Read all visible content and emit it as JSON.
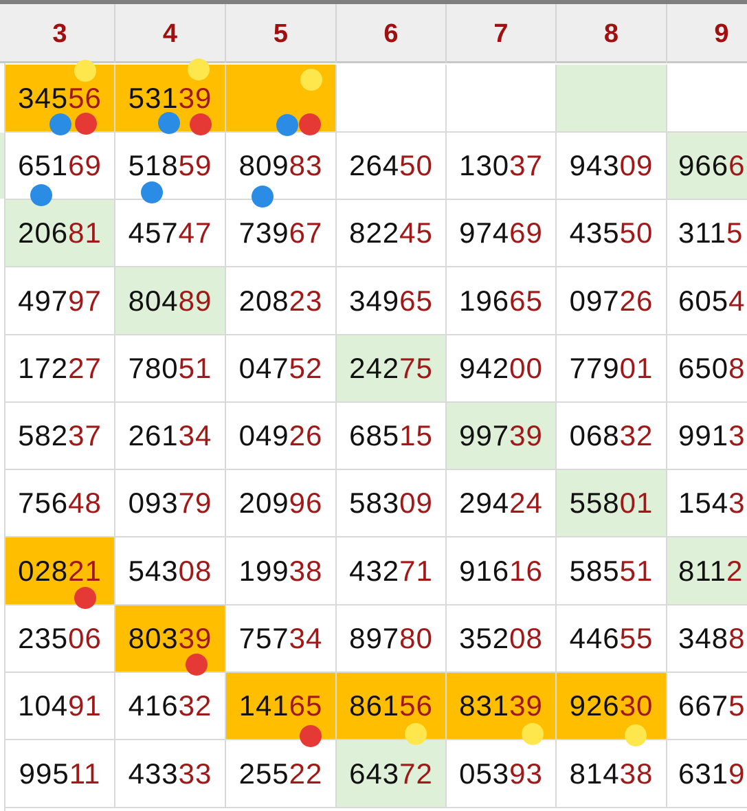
{
  "header": {
    "columns": [
      "3",
      "4",
      "5",
      "6",
      "7",
      "8",
      "9"
    ]
  },
  "colors": {
    "header_text": "#a01010",
    "highlight_digits": "#a01818",
    "orange_cell": "#ffbf00",
    "green_cell": "#dff0d8",
    "marker_yellow": "#fde74c",
    "marker_blue": "#2b8ce6",
    "marker_red": "#e53935"
  },
  "rows": [
    [
      {
        "v": "34556",
        "bg": "orange"
      },
      {
        "v": "53139",
        "bg": "orange"
      },
      {
        "v": "",
        "bg": "orange"
      },
      {
        "v": "",
        "bg": "white"
      },
      {
        "v": "",
        "bg": "white"
      },
      {
        "v": "",
        "bg": "green"
      },
      {
        "v": "",
        "bg": "white"
      }
    ],
    [
      {
        "v": "65169",
        "bg": "white"
      },
      {
        "v": "51859",
        "bg": "white"
      },
      {
        "v": "80983",
        "bg": "white"
      },
      {
        "v": "26450",
        "bg": "white"
      },
      {
        "v": "13037",
        "bg": "white"
      },
      {
        "v": "94309",
        "bg": "white"
      },
      {
        "v": "9666",
        "bg": "green"
      }
    ],
    [
      {
        "v": "20681",
        "bg": "green"
      },
      {
        "v": "45747",
        "bg": "white"
      },
      {
        "v": "73967",
        "bg": "white"
      },
      {
        "v": "82245",
        "bg": "white"
      },
      {
        "v": "97469",
        "bg": "white"
      },
      {
        "v": "43550",
        "bg": "white"
      },
      {
        "v": "3115",
        "bg": "white"
      }
    ],
    [
      {
        "v": "49797",
        "bg": "white"
      },
      {
        "v": "80489",
        "bg": "green"
      },
      {
        "v": "20823",
        "bg": "white"
      },
      {
        "v": "34965",
        "bg": "white"
      },
      {
        "v": "19665",
        "bg": "white"
      },
      {
        "v": "09726",
        "bg": "white"
      },
      {
        "v": "6054",
        "bg": "white"
      }
    ],
    [
      {
        "v": "17227",
        "bg": "white"
      },
      {
        "v": "78051",
        "bg": "white"
      },
      {
        "v": "04752",
        "bg": "white"
      },
      {
        "v": "24275",
        "bg": "green"
      },
      {
        "v": "94200",
        "bg": "white"
      },
      {
        "v": "77901",
        "bg": "white"
      },
      {
        "v": "6508",
        "bg": "white"
      }
    ],
    [
      {
        "v": "58237",
        "bg": "white"
      },
      {
        "v": "26134",
        "bg": "white"
      },
      {
        "v": "04926",
        "bg": "white"
      },
      {
        "v": "68515",
        "bg": "white"
      },
      {
        "v": "99739",
        "bg": "green"
      },
      {
        "v": "06832",
        "bg": "white"
      },
      {
        "v": "9913",
        "bg": "white"
      }
    ],
    [
      {
        "v": "75648",
        "bg": "white"
      },
      {
        "v": "09379",
        "bg": "white"
      },
      {
        "v": "20996",
        "bg": "white"
      },
      {
        "v": "58309",
        "bg": "white"
      },
      {
        "v": "29424",
        "bg": "white"
      },
      {
        "v": "55801",
        "bg": "green"
      },
      {
        "v": "1543",
        "bg": "white"
      }
    ],
    [
      {
        "v": "02821",
        "bg": "orange"
      },
      {
        "v": "54308",
        "bg": "white"
      },
      {
        "v": "19938",
        "bg": "white"
      },
      {
        "v": "43271",
        "bg": "white"
      },
      {
        "v": "91616",
        "bg": "white"
      },
      {
        "v": "58551",
        "bg": "white"
      },
      {
        "v": "8112",
        "bg": "green"
      }
    ],
    [
      {
        "v": "23506",
        "bg": "white"
      },
      {
        "v": "80339",
        "bg": "orange"
      },
      {
        "v": "75734",
        "bg": "white"
      },
      {
        "v": "89780",
        "bg": "white"
      },
      {
        "v": "35208",
        "bg": "white"
      },
      {
        "v": "44655",
        "bg": "white"
      },
      {
        "v": "3488",
        "bg": "white"
      }
    ],
    [
      {
        "v": "10491",
        "bg": "white"
      },
      {
        "v": "41632",
        "bg": "white"
      },
      {
        "v": "14165",
        "bg": "orange"
      },
      {
        "v": "86156",
        "bg": "orange"
      },
      {
        "v": "83139",
        "bg": "orange"
      },
      {
        "v": "92630",
        "bg": "orange"
      },
      {
        "v": "6675",
        "bg": "white"
      }
    ],
    [
      {
        "v": "99511",
        "bg": "white"
      },
      {
        "v": "43333",
        "bg": "white"
      },
      {
        "v": "25522",
        "bg": "white"
      },
      {
        "v": "64372",
        "bg": "green"
      },
      {
        "v": "05393",
        "bg": "white"
      },
      {
        "v": "81438",
        "bg": "white"
      },
      {
        "v": "6319",
        "bg": "white"
      }
    ]
  ],
  "markers": [
    {
      "color": "yellow",
      "row": 0,
      "col": 0
    },
    {
      "color": "blue",
      "row": 0,
      "col": 0
    },
    {
      "color": "red",
      "row": 0,
      "col": 0
    },
    {
      "color": "yellow",
      "row": 0,
      "col": 1
    },
    {
      "color": "blue",
      "row": 0,
      "col": 1
    },
    {
      "color": "red",
      "row": 0,
      "col": 1
    },
    {
      "color": "yellow",
      "row": 0,
      "col": 2
    },
    {
      "color": "blue",
      "row": 0,
      "col": 2
    },
    {
      "color": "red",
      "row": 0,
      "col": 2
    },
    {
      "color": "blue",
      "row": 1,
      "col": 0
    },
    {
      "color": "blue",
      "row": 1,
      "col": 1
    },
    {
      "color": "blue",
      "row": 1,
      "col": 2
    },
    {
      "color": "red",
      "row": 7,
      "col": 0
    },
    {
      "color": "red",
      "row": 8,
      "col": 1
    },
    {
      "color": "red",
      "row": 9,
      "col": 2
    },
    {
      "color": "yellow",
      "row": 9,
      "col": 3
    },
    {
      "color": "yellow",
      "row": 9,
      "col": 4
    },
    {
      "color": "yellow",
      "row": 9,
      "col": 5
    }
  ]
}
